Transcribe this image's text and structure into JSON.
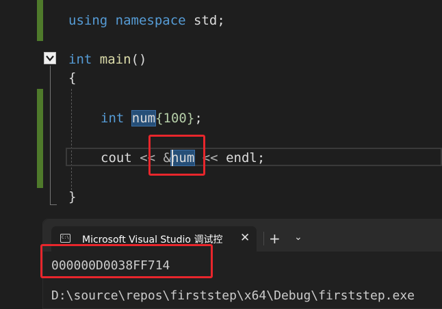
{
  "editor": {
    "line_using": {
      "kw1": "using",
      "kw2": "namespace",
      "rest": " std;"
    },
    "line_main": {
      "type": "int",
      "name": "main",
      "parens": "()"
    },
    "open_brace": "{",
    "line_decl": {
      "type": "int",
      "var": "num",
      "init": "{100}",
      "semi": ";"
    },
    "line_cout": {
      "obj": "cout",
      "op1": " << &",
      "var": "num",
      "op2": " << ",
      "endl": "endl",
      "semi": ";"
    },
    "close_brace": "}"
  },
  "console": {
    "tab_title": "Microsoft Visual Studio 调试控制台",
    "close_glyph": "✕",
    "new_tab_glyph": "+",
    "menu_glyph": "⌄",
    "icon_text": "C:\\",
    "output_address": "000000D0038FF714",
    "output_next": "D:\\source\\repos\\firststep\\x64\\Debug\\firststep.exe"
  }
}
